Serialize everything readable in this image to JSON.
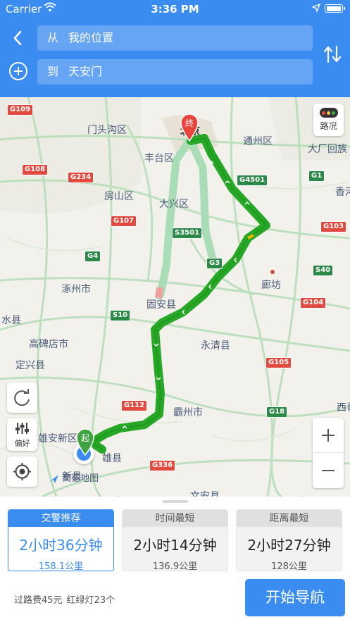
{
  "status_bar": {
    "carrier": "Carrier",
    "time": "3:36 PM"
  },
  "search": {
    "from_prefix": "从",
    "from_value": "我的位置",
    "to_prefix": "到",
    "to_value": "天安门"
  },
  "map": {
    "traffic_label": "路况",
    "preference_label": "偏好",
    "logo_text": "高德地图",
    "start_marker": "起",
    "end_marker": "终",
    "place_labels": [
      "门头沟区",
      "北京",
      "通州区",
      "大厂回族",
      "丰台区",
      "香河",
      "房山区",
      "大兴区",
      "廊坊",
      "涿州市",
      "固安县",
      "水县",
      "永清县",
      "高碑店市",
      "定兴县",
      "霸州市",
      "西青",
      "雄安新区",
      "雄县",
      "新县",
      "文安县"
    ],
    "road_signs": [
      "G109",
      "G108",
      "G234",
      "G107",
      "G4501",
      "G1",
      "S3501",
      "G103",
      "G3",
      "G4",
      "S40",
      "S10",
      "G104",
      "G105",
      "G112",
      "G18",
      "G336"
    ]
  },
  "routes": [
    {
      "tag": "交警推荐",
      "duration": "2小时36分钟",
      "distance": "158.1公里",
      "selected": true
    },
    {
      "tag": "时间最短",
      "duration": "2小时14分钟",
      "distance": "136.9公里",
      "selected": false
    },
    {
      "tag": "距离最短",
      "duration": "2小时27分钟",
      "distance": "128公里",
      "selected": false
    }
  ],
  "summary": {
    "toll": "过路费45元",
    "lights": "红绿灯23个"
  },
  "start_button_label": "开始导航",
  "colors": {
    "accent": "#3a8cf0",
    "route": "#26a826",
    "alt_route": "#a8ddb5",
    "road_sign": "#e34a3f",
    "road_sign_green": "#2c8a48"
  }
}
